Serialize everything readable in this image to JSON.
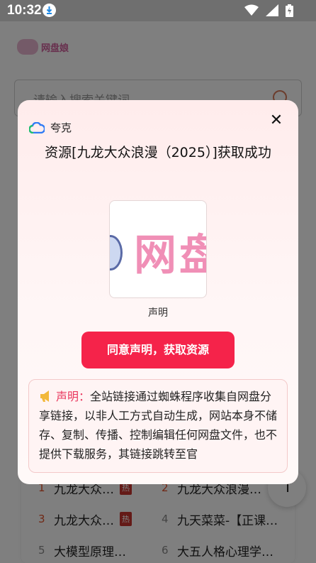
{
  "status_bar": {
    "time": "10:32"
  },
  "background": {
    "logo_name": "网盘娘",
    "search_placeholder": "请输入搜索关键词",
    "hot_items": [
      {
        "rank": "1",
        "title": "九龙大众…",
        "badge": "热"
      },
      {
        "rank": "2",
        "title": "九龙大众浪漫…",
        "badge": ""
      },
      {
        "rank": "3",
        "title": "九龙大众…",
        "badge": "热"
      },
      {
        "rank": "4",
        "title": "九天菜菜-【正课…",
        "badge": ""
      },
      {
        "rank": "5",
        "title": "大模型原理…",
        "badge": ""
      },
      {
        "rank": "6",
        "title": "大五人格心理学…",
        "badge": ""
      }
    ],
    "back_top_glyph": "↑"
  },
  "modal": {
    "brand": "夸克",
    "close_glyph": "✕",
    "headline": "资源[九龙大众浪漫（2025）]获取成功",
    "thumb_text": "网盘",
    "thumb_caption": "声明",
    "agree_button": "同意声明，获取资源",
    "notice_label": "声明：",
    "notice_text": "全站链接通过蜘蛛程序收集自网盘分享链接，以非人工方式自动生成，网站本身不储存、复制、传播、控制编辑任何网盘文件，也不提供下载服务，其链接跳转至官"
  },
  "colors": {
    "accent": "#f5234a",
    "notice_label": "#e9385e",
    "status_bar": "#6f6f6f"
  },
  "icons": [
    "download-icon",
    "wifi-icon",
    "signal-icon",
    "battery-icon",
    "quark-cloud-icon",
    "close-icon",
    "speaker-icon",
    "search-icon",
    "arrow-up-icon"
  ]
}
